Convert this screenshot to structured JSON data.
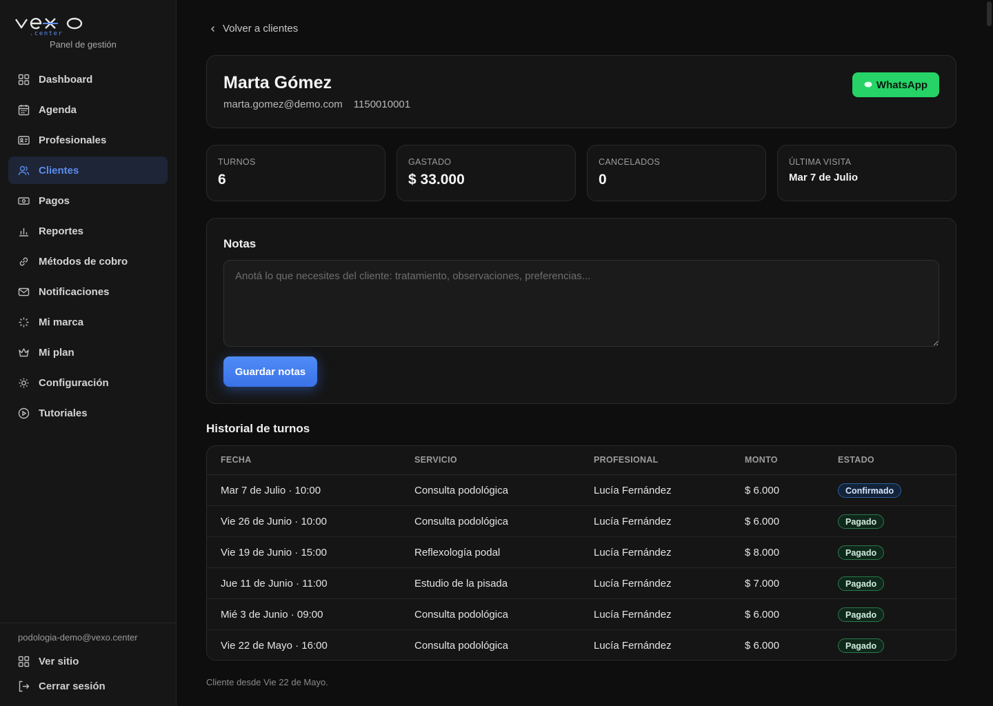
{
  "brand": {
    "subtitle": "Panel de gestión",
    "accent": "#5b8def",
    "success": "#25d366"
  },
  "sidebar": {
    "items": [
      {
        "label": "Dashboard",
        "icon": "grid-icon"
      },
      {
        "label": "Agenda",
        "icon": "calendar-icon"
      },
      {
        "label": "Profesionales",
        "icon": "id-card-icon"
      },
      {
        "label": "Clientes",
        "icon": "users-icon",
        "active": true
      },
      {
        "label": "Pagos",
        "icon": "banknote-icon"
      },
      {
        "label": "Reportes",
        "icon": "bar-chart-icon"
      },
      {
        "label": "Métodos de cobro",
        "icon": "link-icon"
      },
      {
        "label": "Notificaciones",
        "icon": "mail-icon"
      },
      {
        "label": "Mi marca",
        "icon": "sparkle-icon"
      },
      {
        "label": "Mi plan",
        "icon": "crown-icon"
      },
      {
        "label": "Configuración",
        "icon": "sun-gear-icon"
      },
      {
        "label": "Tutoriales",
        "icon": "play-circle-icon"
      }
    ],
    "footer": {
      "email": "podologia-demo@vexo.center",
      "view_site": "Ver sitio",
      "logout": "Cerrar sesión"
    }
  },
  "back": {
    "label": "Volver a clientes"
  },
  "client": {
    "name": "Marta Gómez",
    "email": "marta.gomez@demo.com",
    "phone": "1150010001",
    "whatsapp_label": "WhatsApp"
  },
  "stats": [
    {
      "label": "TURNOS",
      "value": "6"
    },
    {
      "label": "GASTADO",
      "value": "$ 33.000"
    },
    {
      "label": "CANCELADOS",
      "value": "0"
    },
    {
      "label": "ÚLTIMA VISITA",
      "value": "Mar 7 de Julio"
    }
  ],
  "notes": {
    "title": "Notas",
    "value": "",
    "placeholder": "Anotá lo que necesites del cliente: tratamiento, observaciones, preferencias...",
    "save_label": "Guardar notas"
  },
  "history": {
    "title": "Historial de turnos",
    "columns": [
      "FECHA",
      "SERVICIO",
      "PROFESIONAL",
      "MONTO",
      "ESTADO"
    ],
    "rows": [
      {
        "fecha": "Mar 7 de Julio · 10:00",
        "servicio": "Consulta podológica",
        "profesional": "Lucía Fernández",
        "monto": "$ 6.000",
        "estado": "Confirmado"
      },
      {
        "fecha": "Vie 26 de Junio · 10:00",
        "servicio": "Consulta podológica",
        "profesional": "Lucía Fernández",
        "monto": "$ 6.000",
        "estado": "Pagado"
      },
      {
        "fecha": "Vie 19 de Junio · 15:00",
        "servicio": "Reflexología podal",
        "profesional": "Lucía Fernández",
        "monto": "$ 8.000",
        "estado": "Pagado"
      },
      {
        "fecha": "Jue 11 de Junio · 11:00",
        "servicio": "Estudio de la pisada",
        "profesional": "Lucía Fernández",
        "monto": "$ 7.000",
        "estado": "Pagado"
      },
      {
        "fecha": "Mié 3 de Junio · 09:00",
        "servicio": "Consulta podológica",
        "profesional": "Lucía Fernández",
        "monto": "$ 6.000",
        "estado": "Pagado"
      },
      {
        "fecha": "Vie 22 de Mayo · 16:00",
        "servicio": "Consulta podológica",
        "profesional": "Lucía Fernández",
        "monto": "$ 6.000",
        "estado": "Pagado"
      }
    ],
    "footer": "Cliente desde Vie 22 de Mayo."
  }
}
